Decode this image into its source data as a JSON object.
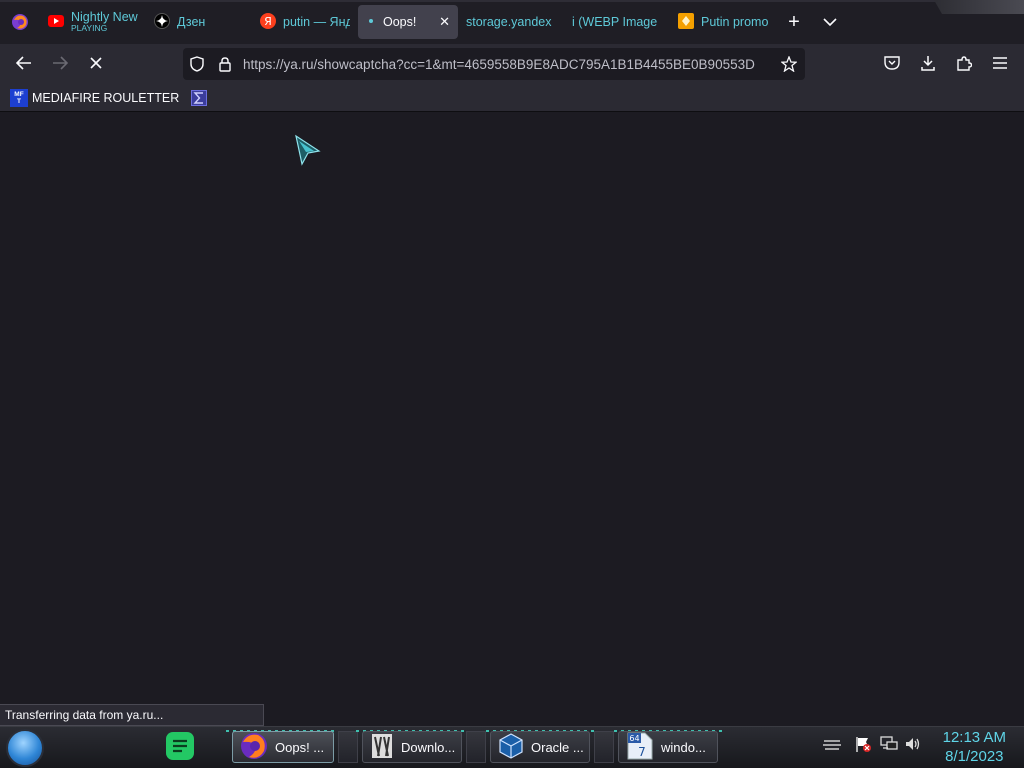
{
  "browser": {
    "tabs": [
      {
        "title": "Nightly News",
        "subtitle": "PLAYING",
        "icon": "youtube-icon"
      },
      {
        "title": "Дзен",
        "icon": "dzen-icon"
      },
      {
        "title": "putin — Яндекс",
        "icon": "yandex-icon"
      },
      {
        "title": "Oops!",
        "icon": "loading-dot-icon",
        "active": true
      },
      {
        "title": "storage.yandex",
        "icon": "none"
      },
      {
        "title": "i (WEBP Image",
        "icon": "none"
      },
      {
        "title": "Putin promo",
        "icon": "tab-orange-icon"
      }
    ],
    "url": "https://ya.ru/showcaptcha?cc=1&mt=4659558B9E8ADC795A1B1B4455BE0B90553D",
    "bookmarks": [
      {
        "label": "MEDIAFIRE ROULETTER",
        "icon": "mediafire-icon",
        "icon_text_top": "MF",
        "icon_text_bottom": "T"
      },
      {
        "label": "",
        "icon": "sigma-icon"
      }
    ],
    "status_text": "Transferring data from ya.ru..."
  },
  "taskbar": {
    "apps": [
      {
        "label": "Oops! ...",
        "icon": "firefox-icon",
        "active": true
      },
      {
        "label": "Downlo...",
        "icon": "downloads-icon"
      },
      {
        "label": "Oracle ...",
        "icon": "virtualbox-icon"
      },
      {
        "label": "windo...",
        "icon": "windows7-iso-icon",
        "badge": "64"
      }
    ],
    "clock": {
      "time": "12:13 AM",
      "date": "8/1/2023"
    },
    "colors": {
      "accent": "#5fd5e8",
      "tab_text": "#5ec9d8"
    }
  }
}
